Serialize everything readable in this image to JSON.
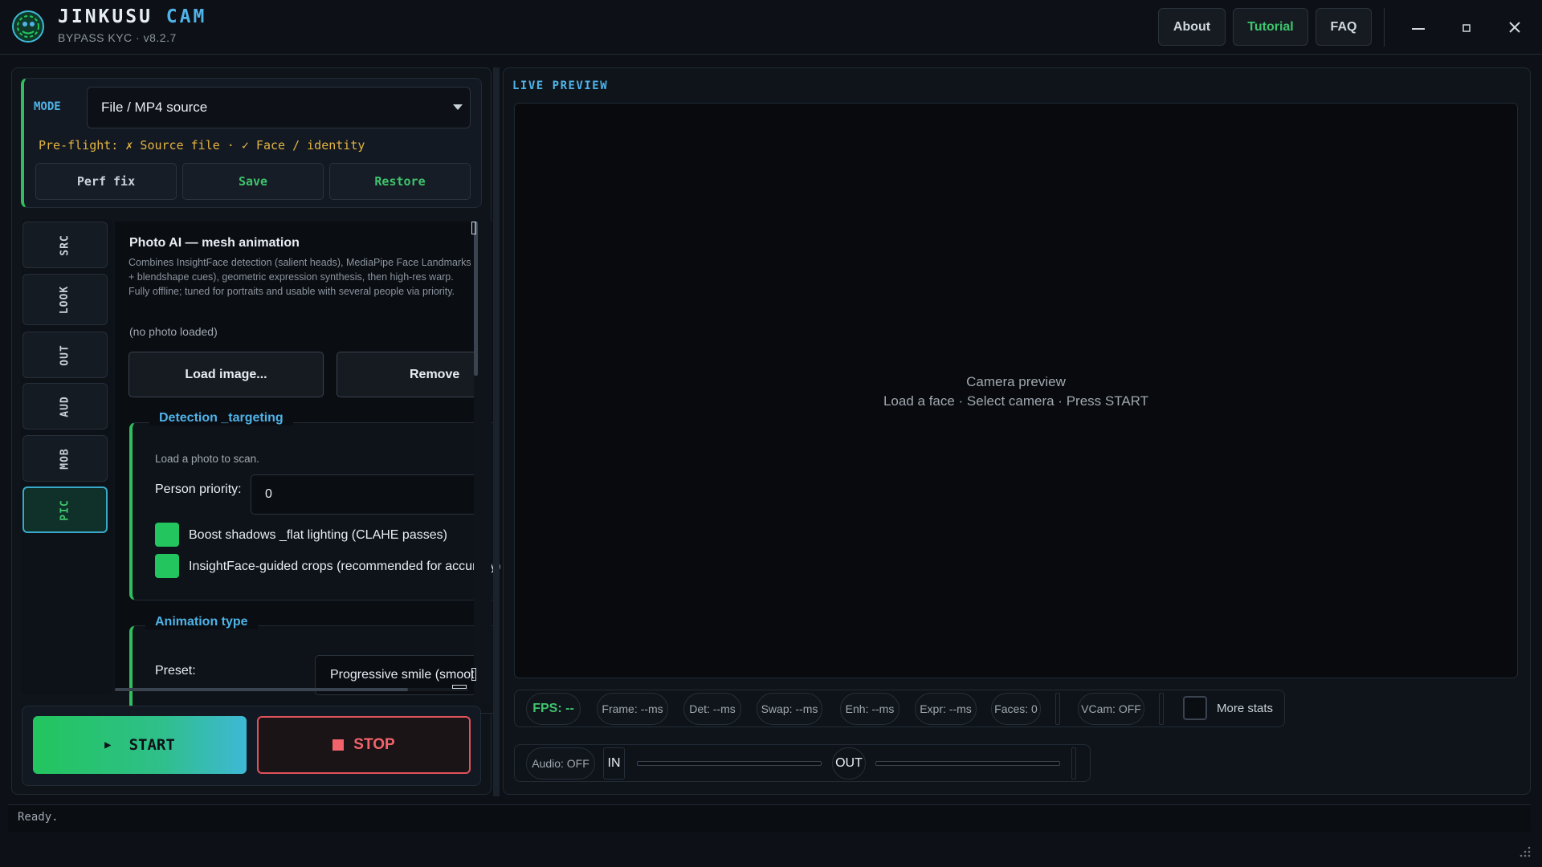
{
  "app": {
    "title_main": "JINKUSU",
    "title_accent": "CAM",
    "subtitle": "BYPASS KYC · v8.2.7"
  },
  "topbar": {
    "about": "About",
    "tutorial": "Tutorial",
    "faq": "FAQ"
  },
  "mode_card": {
    "label": "MODE",
    "selected": "File / MP4 source",
    "preflight": "Pre-flight: ✗ Source file · ✓ Face / identity",
    "perf_fix": "Perf fix",
    "save": "Save",
    "restore": "Restore"
  },
  "tabs": [
    {
      "label": "SRC"
    },
    {
      "label": "LOOK"
    },
    {
      "label": "OUT"
    },
    {
      "label": "AUD"
    },
    {
      "label": "MOB"
    },
    {
      "label": "PIC",
      "active": true
    }
  ],
  "pic_panel": {
    "title": "Photo AI — mesh animation",
    "description": "Combines InsightFace detection (salient heads), MediaPipe Face Landmarks + blendshape cues), geometric expression synthesis, then high-res warp. Fully offline; tuned for portraits and usable with several people via priority.",
    "status": "(no photo loaded)",
    "load_button": "Load image...",
    "remove_button": "Remove",
    "detection": {
      "title": "Detection _targeting",
      "hint": "Load a photo to scan.",
      "priority_label": "Person priority:",
      "priority_value": "0",
      "boost_shadows": "Boost shadows _flat lighting (CLAHE passes)",
      "insightface_crops": "InsightFace-guided crops (recommended for accuracy)"
    },
    "animation": {
      "title": "Animation type",
      "preset_label": "Preset:",
      "preset_value": "Progressive smile (smooth)"
    }
  },
  "actions": {
    "start": "START",
    "stop": "STOP"
  },
  "preview": {
    "label": "LIVE PREVIEW",
    "line1": "Camera preview",
    "line2": "Load a face  ·  Select camera  ·  Press START"
  },
  "stats": {
    "fps": "FPS: --",
    "frame": "Frame: --ms",
    "det": "Det: --ms",
    "swap": "Swap: --ms",
    "enh": "Enh: --ms",
    "expr": "Expr: --ms",
    "faces": "Faces: 0",
    "vcam": "VCam: OFF",
    "more_stats": "More stats"
  },
  "audio": {
    "status": "Audio: OFF",
    "in": "IN",
    "out": "OUT"
  },
  "statusbar": {
    "text": "Ready."
  },
  "colors": {
    "accent_green": "#22c55e",
    "accent_blue": "#4fb3e8",
    "stop_red": "#f2636b",
    "warning_amber": "#e3b341"
  }
}
